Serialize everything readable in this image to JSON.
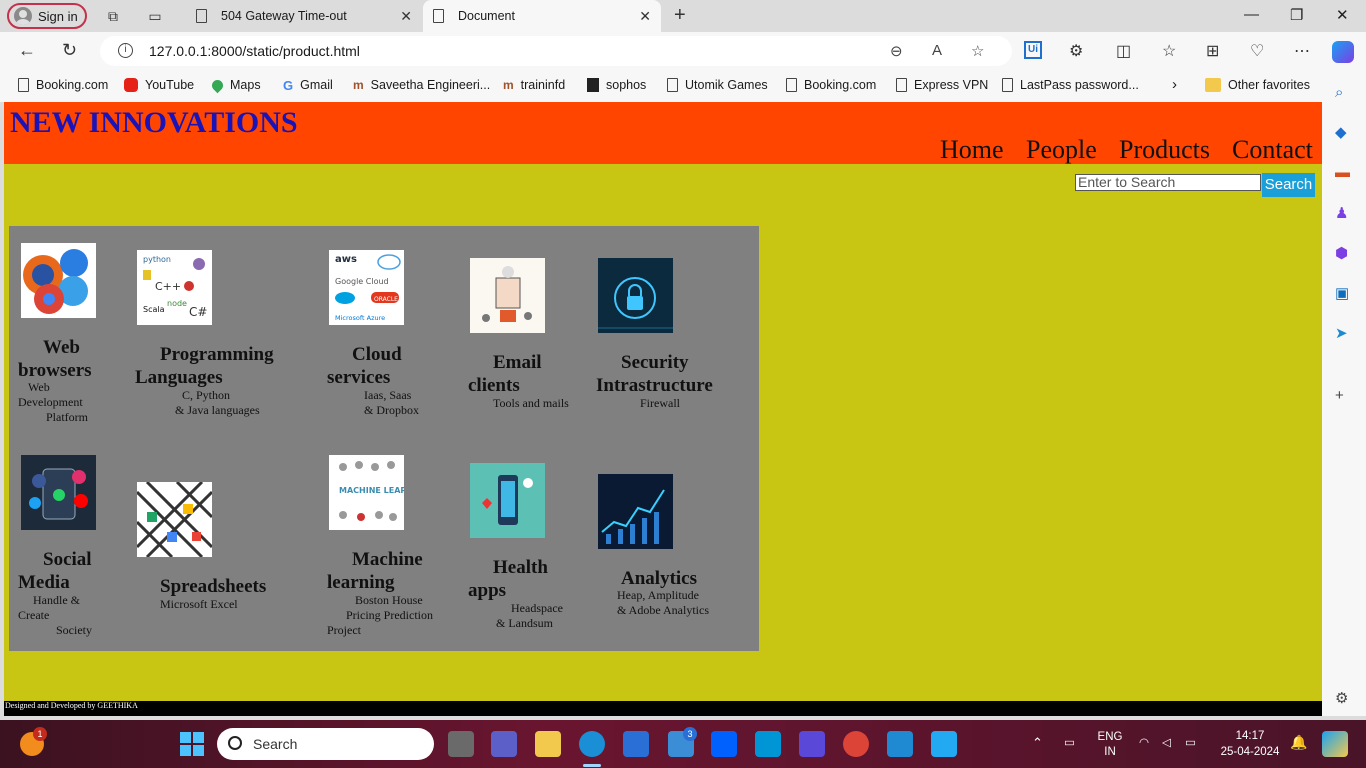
{
  "browser": {
    "profile_label": "Sign in",
    "tabs": [
      {
        "title": "504 Gateway Time-out",
        "active": false
      },
      {
        "title": "Document",
        "active": true
      }
    ],
    "url": "127.0.0.1:8000/static/product.html",
    "favorites": [
      {
        "label": "Booking.com",
        "icon": "doc-icon"
      },
      {
        "label": "YouTube",
        "icon": "youtube-icon"
      },
      {
        "label": "Maps",
        "icon": "maps-icon"
      },
      {
        "label": "Gmail",
        "icon": "google-icon"
      },
      {
        "label": "Saveetha Engineeri...",
        "icon": "site-icon"
      },
      {
        "label": "traininfd",
        "icon": "site-icon"
      },
      {
        "label": "sophos",
        "icon": "sophos-icon"
      },
      {
        "label": "Utomik Games",
        "icon": "doc-icon"
      },
      {
        "label": "Booking.com",
        "icon": "doc-icon"
      },
      {
        "label": "Express VPN",
        "icon": "doc-icon"
      },
      {
        "label": "LastPass password...",
        "icon": "doc-icon"
      }
    ],
    "other_favorites": "Other favorites"
  },
  "site": {
    "brand": "NEW INNOVATIONS",
    "nav": [
      "Home",
      "People",
      "Products",
      "Contact"
    ],
    "search_placeholder": "Enter to Search",
    "search_button": "Search",
    "footer": "Designed and Developed by GEETHIKA"
  },
  "products": [
    {
      "title": [
        "Web",
        "browsers"
      ],
      "desc": [
        "Web",
        "Development",
        "Platform"
      ]
    },
    {
      "title": [
        "Programming",
        "Languages"
      ],
      "desc": [
        "C, Python",
        "& Java languages"
      ]
    },
    {
      "title": [
        "Cloud",
        "services"
      ],
      "desc": [
        "Iaas, Saas",
        "& Dropbox"
      ]
    },
    {
      "title": [
        "Email",
        "clients"
      ],
      "desc": [
        "Tools and mails"
      ]
    },
    {
      "title": [
        "Security",
        "Intrastructure"
      ],
      "desc": [
        "Firewall"
      ]
    },
    {
      "title": [
        "Social",
        "Media"
      ],
      "desc": [
        "Handle &",
        "Create",
        "Society"
      ]
    },
    {
      "title": [
        "Spreadsheets"
      ],
      "desc": [
        "Microsoft Excel"
      ]
    },
    {
      "title": [
        "Machine",
        "learning"
      ],
      "desc": [
        "Boston House",
        "Pricing Prediction",
        "Project"
      ]
    },
    {
      "title": [
        "Health",
        "apps"
      ],
      "desc": [
        "Headspace",
        "& Landsum"
      ]
    },
    {
      "title": [
        "Analytics"
      ],
      "desc": [
        "Heap, Amplitude",
        "& Adobe Analytics"
      ]
    }
  ],
  "image_texts": {
    "cloud_aws": "aws",
    "cloud_google": "Google Cloud",
    "cloud_oracle": "ORACLE",
    "cloud_azure": "Microsoft Azure",
    "ml_label": "MACHINE LEARNING"
  },
  "taskbar": {
    "search_label": "Search",
    "notification_badge": "1",
    "mail_badge": "3",
    "language": "ENG",
    "region": "IN",
    "time": "14:17",
    "date": "25-04-2024"
  }
}
